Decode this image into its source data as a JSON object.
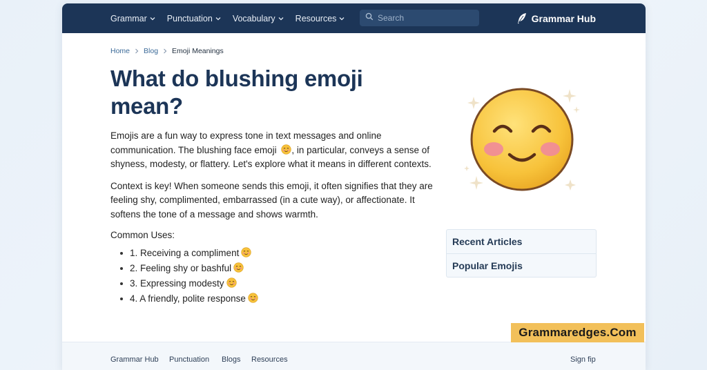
{
  "nav": {
    "items": [
      {
        "label": "Grammar"
      },
      {
        "label": "Punctuation"
      },
      {
        "label": "Vocabulary"
      },
      {
        "label": "Resources"
      }
    ],
    "search_placeholder": "Search",
    "brand": "Grammar Hub"
  },
  "breadcrumb": {
    "home": "Home",
    "blog": "Blog",
    "current": "Emoji Meanings"
  },
  "article": {
    "title": "What do blushing emoji mean?",
    "para1_before": "Emojis are a fun way to express tone in text messages and online communication. The blushing face emoji ",
    "para1_after": ", in particular, conveys a sense of shyness, modesty, or flattery. Let's explore what it means in different contexts.",
    "para2": "Context is key! When someone sends this emoji, it often signifies that they are feeling shy, complimented, embarrassed (in a cute way), or affectionate. It softens the tone of a message and shows warmth.",
    "uses_heading": "Common Uses:",
    "uses": [
      "1.  Receiving a compliment",
      "2. Feeling shy or bashful",
      "3. Expressing modesty",
      "4. A friendly, polite response"
    ]
  },
  "sidebar": {
    "items": [
      "Recent Articles",
      "Popular Emojis"
    ]
  },
  "footer": {
    "links": [
      "Grammar Hub",
      "Punctuation",
      "Blogs",
      "Resources"
    ],
    "signin": "Sign fip"
  },
  "watermark": "Grammaredges.Com",
  "colors": {
    "nav_bg": "#1c3557",
    "title": "#1c3557",
    "watermark_bg": "#f2c05a",
    "emoji_face": "#f7c23a",
    "emoji_blush": "#f08a9a"
  },
  "icons": {
    "search": "search-icon",
    "brand": "feather-icon",
    "dropdown": "chevron-down-icon",
    "breadcrumb_sep": "chevron-right-icon",
    "hero": "blushing-face-emoji"
  }
}
